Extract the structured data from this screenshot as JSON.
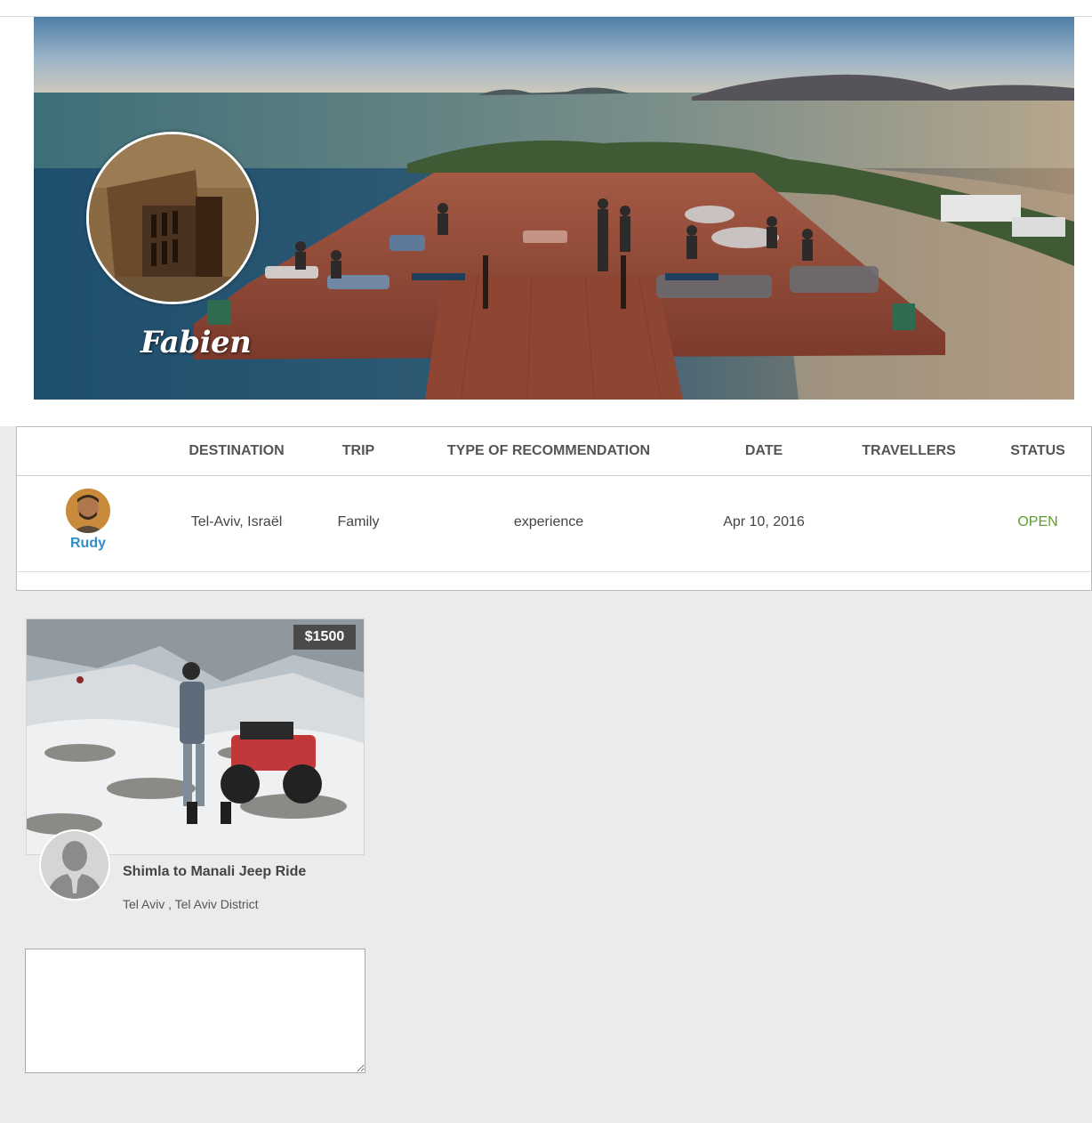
{
  "profile": {
    "name": "Fabien"
  },
  "table": {
    "headers": [
      "DESTINATION",
      "TRIP",
      "TYPE OF RECOMMENDATION",
      "DATE",
      "TRAVELLERS",
      "STATUS"
    ],
    "rows": [
      {
        "user": "Rudy",
        "destination": "Tel-Aviv, Israël",
        "trip": "Family",
        "type": "experience",
        "date": "Apr 10, 2016",
        "travellers": "",
        "status": "OPEN"
      }
    ]
  },
  "card": {
    "price": "$1500",
    "title": "Shimla to Manali Jeep Ride",
    "location": "Tel Aviv , Tel Aviv District"
  },
  "note": {
    "value": ""
  },
  "colors": {
    "status_open": "#5a9e2e",
    "user_link": "#2f8fcc",
    "page_bg": "#ebebeb"
  },
  "icons": {
    "card_author": "person-silhouette-icon"
  }
}
